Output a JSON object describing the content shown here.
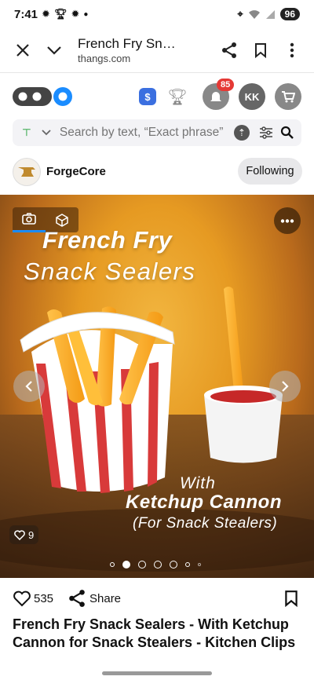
{
  "status_bar": {
    "time": "7:41",
    "battery": "96"
  },
  "browser": {
    "page_title": "French Fry Snack Sealers",
    "domain": "thangs.com"
  },
  "site_header": {
    "notification_count": "85",
    "user_initials": "KK"
  },
  "search": {
    "placeholder": "Search by text, “Exact phrase”"
  },
  "creator": {
    "name": "ForgeCore",
    "follow_label": "Following"
  },
  "hero": {
    "headline_line1": "French Fry",
    "headline_line2": "Snack Sealers",
    "caption_line1": "With",
    "caption_line2": "Ketchup Cannon",
    "caption_line3": "(For Snack Stealers)",
    "image_likes": "9",
    "carousel_total": 7,
    "carousel_active_index": 1
  },
  "actions": {
    "like_count": "535",
    "share_label": "Share"
  },
  "model": {
    "title": "French Fry Snack Sealers - With Ketchup Cannon for Snack Stealers - Kitchen Clips"
  },
  "colors": {
    "accent_blue": "#1a73e8",
    "notification_red": "#e53935",
    "fry_yellow": "#ffb72e",
    "box_red": "#d83a3a"
  }
}
